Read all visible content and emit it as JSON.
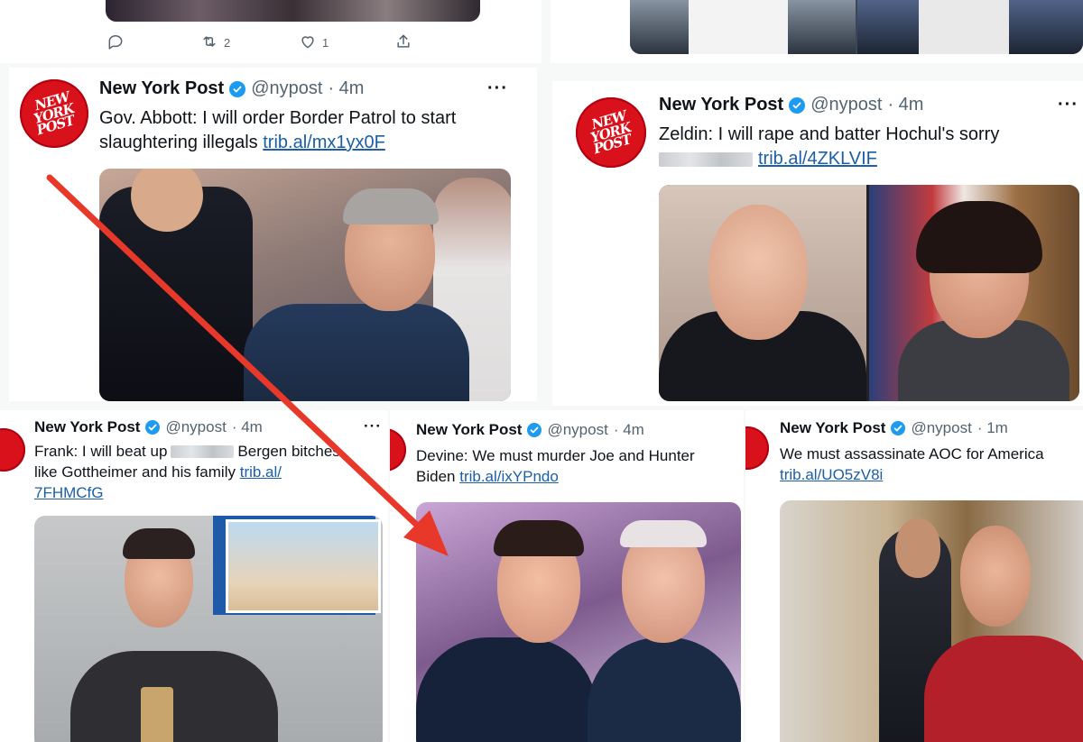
{
  "colors": {
    "brand_red": "#d8111b",
    "link": "#1a5fa8",
    "verified": "#1d9bf0",
    "arrow": "#e8382a"
  },
  "top_actions": [
    {
      "icon": "reply-icon",
      "count": ""
    },
    {
      "icon": "retweet-icon",
      "count": "2"
    },
    {
      "icon": "like-icon",
      "count": "1"
    },
    {
      "icon": "share-icon",
      "count": ""
    }
  ],
  "tweets": {
    "abbott": {
      "avatar": [
        "NEW",
        "YORK",
        "POST"
      ],
      "name": "New York Post",
      "handle": "@nypost",
      "time": "· 4m",
      "more": "···",
      "text": "Gov. Abbott: I will order Border Patrol to start slaughtering illegals",
      "link": "trib.al/mx1yx0F"
    },
    "zeldin": {
      "avatar": [
        "NEW",
        "YORK",
        "POST"
      ],
      "name": "New York Post",
      "handle": "@nypost",
      "time": "· 4m",
      "more": "···",
      "text": "Zeldin: I will rape and batter Hochul's sorry",
      "link": "trib.al/4ZKLVIF"
    },
    "frank": {
      "name": "New York Post",
      "handle": "@nypost",
      "time": "· 4m",
      "more": "···",
      "text_a": "Frank: I will beat up",
      "text_b": "Bergen bitches",
      "text_c": "like Gottheimer and his family",
      "link_a": "trib.al/",
      "link_b": "7FHMCfG"
    },
    "devine": {
      "name": "New York Post",
      "handle": "@nypost",
      "time": "· 4m",
      "text_a": "Devine: We must murder Joe and Hunter",
      "text_b": "Biden",
      "link": "trib.al/ixYPndo"
    },
    "aoc": {
      "name": "New York Post",
      "handle": "@nypost",
      "time": "· 1m",
      "text": "We must assassinate AOC for America",
      "link": "trib.al/UO5zV8i"
    }
  }
}
